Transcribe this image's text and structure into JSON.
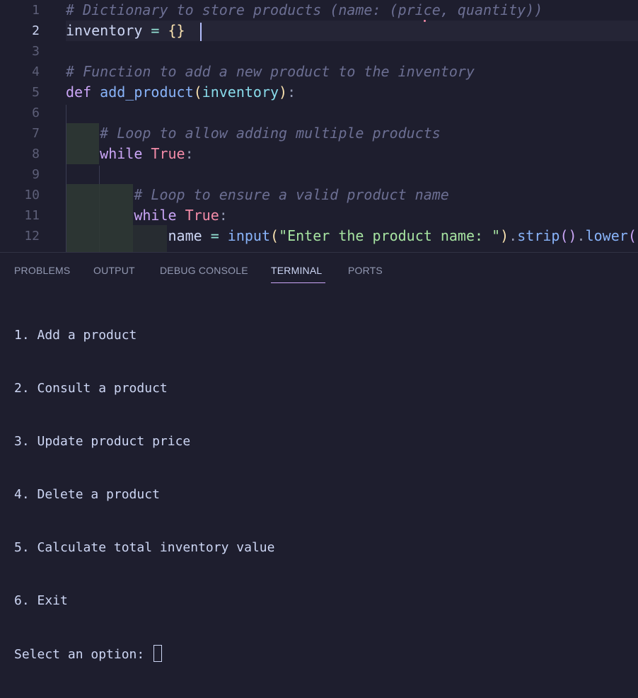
{
  "editor": {
    "lines": [
      {
        "num": "1",
        "tokens": [
          {
            "t": "# Dictionary to store products (name: (price, quantity))",
            "c": "cm"
          }
        ]
      },
      {
        "num": "2",
        "tokens": [
          {
            "t": "inventory",
            "c": "var"
          },
          {
            "t": " = ",
            "c": "op"
          },
          {
            "t": "{}",
            "c": "br"
          }
        ]
      },
      {
        "num": "3",
        "tokens": []
      },
      {
        "num": "4",
        "tokens": [
          {
            "t": "# Function to add a new product to the inventory",
            "c": "cm"
          }
        ]
      },
      {
        "num": "5",
        "tokens": [
          {
            "t": "def ",
            "c": "kw"
          },
          {
            "t": "add_product",
            "c": "fn"
          },
          {
            "t": "(",
            "c": "br"
          },
          {
            "t": "inventory",
            "c": "prm"
          },
          {
            "t": ")",
            "c": "br"
          },
          {
            "t": ":",
            "c": "punct"
          }
        ]
      },
      {
        "num": "6",
        "tokens": []
      },
      {
        "num": "7",
        "tokens": [
          {
            "t": "    ",
            "c": "var"
          },
          {
            "t": "# Loop to allow adding multiple products",
            "c": "cm"
          }
        ]
      },
      {
        "num": "8",
        "tokens": [
          {
            "t": "    ",
            "c": "var"
          },
          {
            "t": "while ",
            "c": "kw"
          },
          {
            "t": "True",
            "c": "bool"
          },
          {
            "t": ":",
            "c": "punct"
          }
        ]
      },
      {
        "num": "9",
        "tokens": []
      },
      {
        "num": "10",
        "tokens": [
          {
            "t": "        ",
            "c": "var"
          },
          {
            "t": "# Loop to ensure a valid product name",
            "c": "cm"
          }
        ]
      },
      {
        "num": "11",
        "tokens": [
          {
            "t": "        ",
            "c": "var"
          },
          {
            "t": "while ",
            "c": "kw"
          },
          {
            "t": "True",
            "c": "bool"
          },
          {
            "t": ":",
            "c": "punct"
          }
        ]
      },
      {
        "num": "12",
        "tokens": [
          {
            "t": "            ",
            "c": "var"
          },
          {
            "t": "name",
            "c": "var"
          },
          {
            "t": " = ",
            "c": "op"
          },
          {
            "t": "input",
            "c": "fn"
          },
          {
            "t": "(",
            "c": "br"
          },
          {
            "t": "\"Enter the product name: \"",
            "c": "str"
          },
          {
            "t": ")",
            "c": "br"
          },
          {
            "t": ".",
            "c": "punct"
          },
          {
            "t": "strip",
            "c": "fn"
          },
          {
            "t": "()",
            "c": "br2"
          },
          {
            "t": ".",
            "c": "punct"
          },
          {
            "t": "lower",
            "c": "fn"
          },
          {
            "t": "()",
            "c": "br2"
          }
        ]
      }
    ],
    "active_line": "2"
  },
  "panel": {
    "tabs": [
      {
        "label": "PROBLEMS"
      },
      {
        "label": "OUTPUT"
      },
      {
        "label": "DEBUG CONSOLE"
      },
      {
        "label": "TERMINAL"
      },
      {
        "label": "PORTS"
      }
    ],
    "active_tab": "TERMINAL"
  },
  "terminal": {
    "lines": [
      "1. Add a product",
      "2. Consult a product",
      "3. Update product price",
      "4. Delete a product",
      "5. Calculate total inventory value",
      "6. Exit"
    ],
    "prompt": "Select an option: "
  },
  "colors": {
    "background": "#1e1e2e",
    "comment": "#6c6f93",
    "keyword": "#cba6f7",
    "function": "#89b4fa",
    "string": "#a6e3a1",
    "boolean": "#f38ba8",
    "active_tab_underline": "#cba6f7"
  }
}
